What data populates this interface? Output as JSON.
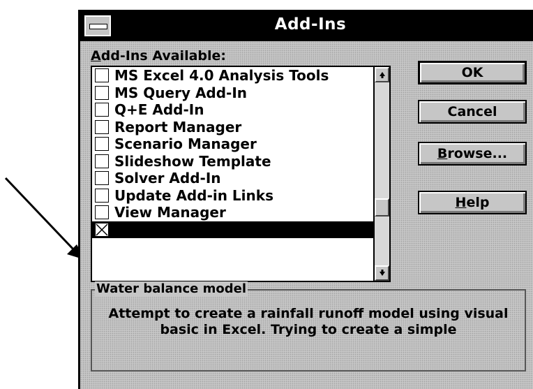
{
  "window": {
    "title": "Add-Ins"
  },
  "addins_list": {
    "label": "Add-Ins Available:",
    "items": [
      {
        "label": "MS Excel 4.0 Analysis Tools",
        "checked": false
      },
      {
        "label": "MS Query Add-In",
        "checked": false
      },
      {
        "label": "Q+E Add-In",
        "checked": false
      },
      {
        "label": "Report Manager",
        "checked": false
      },
      {
        "label": "Scenario Manager",
        "checked": false
      },
      {
        "label": "Slideshow Template",
        "checked": false
      },
      {
        "label": "Solver Add-In",
        "checked": false
      },
      {
        "label": "Update Add-in Links",
        "checked": false
      },
      {
        "label": "View Manager",
        "checked": false
      },
      {
        "label": "",
        "checked": true,
        "selected": true
      }
    ]
  },
  "buttons": {
    "ok": "OK",
    "cancel": "Cancel",
    "browse": "Browse...",
    "help": "Help"
  },
  "description": {
    "title": "Water balance model",
    "text": "Attempt to create a rainfall runoff model using visual basic in Excel. Trying to create a simple"
  },
  "icons": {
    "scroll_up": "arrow-up-icon",
    "scroll_down": "arrow-down-icon",
    "annotation": "arrow-pointer-icon"
  }
}
